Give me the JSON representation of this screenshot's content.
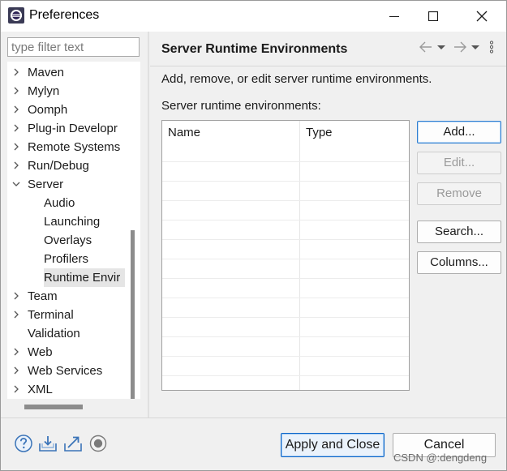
{
  "window": {
    "title": "Preferences"
  },
  "filter": {
    "placeholder": "type filter text"
  },
  "tree": {
    "items": [
      {
        "label": "Maven",
        "expandable": true,
        "expanded": false,
        "level": 0
      },
      {
        "label": "Mylyn",
        "expandable": true,
        "expanded": false,
        "level": 0
      },
      {
        "label": "Oomph",
        "expandable": true,
        "expanded": false,
        "level": 0
      },
      {
        "label": "Plug-in Developr",
        "expandable": true,
        "expanded": false,
        "level": 0
      },
      {
        "label": "Remote Systems",
        "expandable": true,
        "expanded": false,
        "level": 0
      },
      {
        "label": "Run/Debug",
        "expandable": true,
        "expanded": false,
        "level": 0
      },
      {
        "label": "Server",
        "expandable": true,
        "expanded": true,
        "level": 0
      },
      {
        "label": "Audio",
        "expandable": false,
        "level": 1
      },
      {
        "label": "Launching",
        "expandable": false,
        "level": 1
      },
      {
        "label": "Overlays",
        "expandable": false,
        "level": 1
      },
      {
        "label": "Profilers",
        "expandable": false,
        "level": 1
      },
      {
        "label": "Runtime Envir",
        "expandable": false,
        "level": 1,
        "selected": true
      },
      {
        "label": "Team",
        "expandable": true,
        "expanded": false,
        "level": 0
      },
      {
        "label": "Terminal",
        "expandable": true,
        "expanded": false,
        "level": 0
      },
      {
        "label": "Validation",
        "expandable": false,
        "level": 0
      },
      {
        "label": "Web",
        "expandable": true,
        "expanded": false,
        "level": 0
      },
      {
        "label": "Web Services",
        "expandable": true,
        "expanded": false,
        "level": 0
      },
      {
        "label": "XML",
        "expandable": true,
        "expanded": false,
        "level": 0
      }
    ]
  },
  "page": {
    "title": "Server Runtime Environments",
    "description": "Add, remove, or edit server runtime environments.",
    "list_label": "Server runtime environments:",
    "table": {
      "columns": [
        "Name",
        "Type"
      ],
      "rows": []
    },
    "buttons": {
      "add": "Add...",
      "edit": "Edit...",
      "remove": "Remove",
      "search": "Search...",
      "columns": "Columns..."
    }
  },
  "footer": {
    "apply_close": "Apply and Close",
    "cancel": "Cancel",
    "watermark": "CSDN @:dengdeng"
  },
  "icons": {
    "app": "eclipse-icon",
    "help": "help-icon",
    "import": "import-icon",
    "export": "export-icon",
    "record": "record-icon"
  },
  "colors": {
    "accent": "#0a64c8",
    "selection": "#e5e5e5"
  }
}
